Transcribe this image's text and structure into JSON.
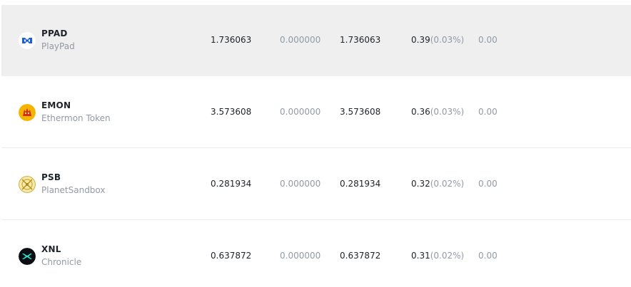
{
  "rows": [
    {
      "symbol": "PPAD",
      "name": "PlayPad",
      "icon": "playpad-logo-icon",
      "total": "1.736063",
      "locked": "0.000000",
      "available": "1.736063",
      "btc_value": "0.39",
      "btc_pct": "(0.03%)",
      "usd_value": "0.00",
      "highlighted": true
    },
    {
      "symbol": "EMON",
      "name": "Ethermon Token",
      "icon": "ethermon-logo-icon",
      "total": "3.573608",
      "locked": "0.000000",
      "available": "3.573608",
      "btc_value": "0.36",
      "btc_pct": "(0.03%)",
      "usd_value": "0.00",
      "highlighted": false
    },
    {
      "symbol": "PSB",
      "name": "PlanetSandbox",
      "icon": "planetsandbox-logo-icon",
      "total": "0.281934",
      "locked": "0.000000",
      "available": "0.281934",
      "btc_value": "0.32",
      "btc_pct": "(0.02%)",
      "usd_value": "0.00",
      "highlighted": false
    },
    {
      "symbol": "XNL",
      "name": "Chronicle",
      "icon": "chronicle-logo-icon",
      "total": "0.637872",
      "locked": "0.000000",
      "available": "0.637872",
      "btc_value": "0.31",
      "btc_pct": "(0.02%)",
      "usd_value": "0.00",
      "highlighted": false
    }
  ],
  "colors": {
    "text_primary": "#1e2329",
    "text_muted": "#929aa5",
    "row_hover": "#efefef",
    "divider": "#eaecef"
  }
}
